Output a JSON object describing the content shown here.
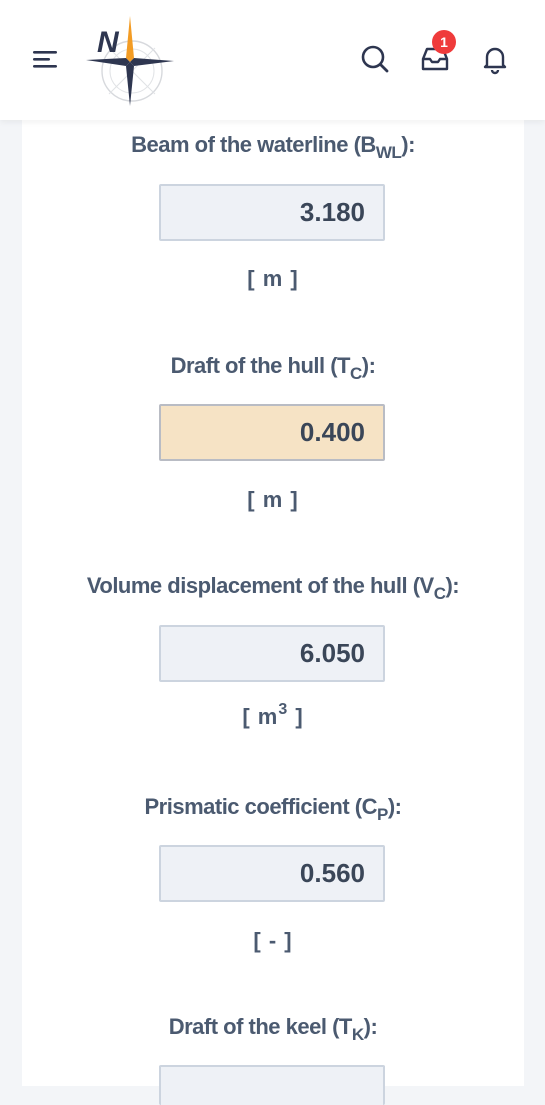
{
  "header": {
    "logo_letter": "N",
    "notification_count": "1"
  },
  "fields": [
    {
      "label": "Beam of the waterline (B",
      "sub": "WL",
      "label_end": "):",
      "value": "3.180",
      "unit": "[ m ]",
      "unit_sup": ""
    },
    {
      "label": "Draft of the hull (T",
      "sub": "C",
      "label_end": "):",
      "value": "0.400",
      "unit": "[ m ]",
      "unit_sup": ""
    },
    {
      "label": "Volume displacement of the hull (V",
      "sub": "C",
      "label_end": "):",
      "value": "6.050",
      "unit_pre": "[ m",
      "unit_sup": "3",
      "unit_post": " ]"
    },
    {
      "label": "Prismatic coefficient (C",
      "sub": "P",
      "label_end": "):",
      "value": "0.560",
      "unit": "[ - ]",
      "unit_sup": ""
    },
    {
      "label": "Draft of the keel (T",
      "sub": "K",
      "label_end": "):",
      "value": "",
      "unit": "",
      "unit_sup": ""
    }
  ]
}
